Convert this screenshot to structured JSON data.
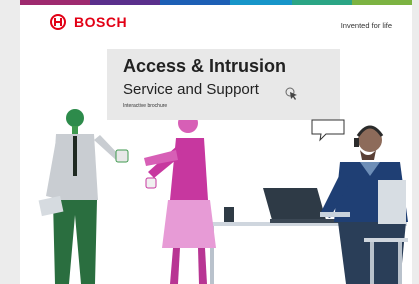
{
  "brand": {
    "name": "BOSCH",
    "tagline": "Invented for life"
  },
  "hero": {
    "title": "Access & Intrusion",
    "subtitle": "Service and Support",
    "note": "Interactive brochure"
  },
  "icons": [
    "bosch-logo-icon",
    "cursor-pointer-icon"
  ],
  "colors": {
    "bosch_red": "#e20015",
    "stripe": [
      "#9e2a6f",
      "#5a2f8c",
      "#1d5fb5",
      "#1795c9",
      "#2ba585",
      "#7cb342"
    ],
    "green_person": "#3f9a4f",
    "pink_person": "#d75fb6",
    "blue_person": "#1f3f74"
  }
}
